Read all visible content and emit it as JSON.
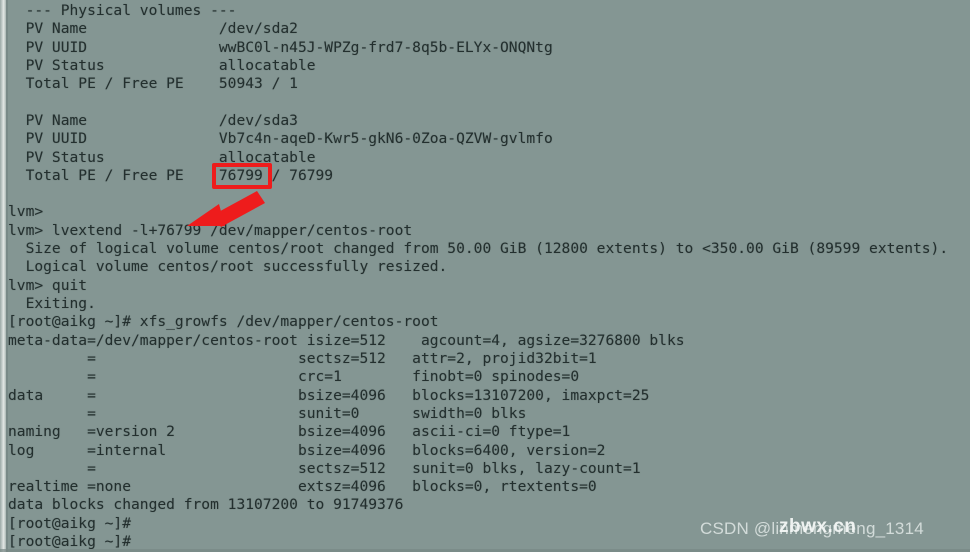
{
  "terminal": {
    "background_color": "#849693",
    "text_color": "#232f2e",
    "lines": [
      "  --- Physical volumes ---",
      "  PV Name               /dev/sda2",
      "  PV UUID               wwBC0l-n45J-WPZg-frd7-8q5b-ELYx-ONQNtg",
      "  PV Status             allocatable",
      "  Total PE / Free PE    50943 / 1",
      "",
      "  PV Name               /dev/sda3",
      "  PV UUID               Vb7c4n-aqeD-Kwr5-gkN6-0Zoa-QZVW-gvlmfo",
      "  PV Status             allocatable",
      "  Total PE / Free PE    76799 / 76799",
      "",
      "lvm>",
      "lvm> lvextend -l+76799 /dev/mapper/centos-root",
      "  Size of logical volume centos/root changed from 50.00 GiB (12800 extents) to <350.00 GiB (89599 extents).",
      "  Logical volume centos/root successfully resized.",
      "lvm> quit",
      "  Exiting.",
      "[root@aikg ~]# xfs_growfs /dev/mapper/centos-root",
      "meta-data=/dev/mapper/centos-root isize=512    agcount=4, agsize=3276800 blks",
      "         =                       sectsz=512   attr=2, projid32bit=1",
      "         =                       crc=1        finobt=0 spinodes=0",
      "data     =                       bsize=4096   blocks=13107200, imaxpct=25",
      "         =                       sunit=0      swidth=0 blks",
      "naming   =version 2              bsize=4096   ascii-ci=0 ftype=1",
      "log      =internal               bsize=4096   blocks=6400, version=2",
      "         =                       sectsz=512   sunit=0 blks, lazy-count=1",
      "realtime =none                   extsz=4096   blocks=0, rtextents=0",
      "data blocks changed from 13107200 to 91749376",
      "[root@aikg ~]#",
      "[root@aikg ~]#"
    ]
  },
  "annotations": {
    "color": "#ee1c1c",
    "highlight_box": {
      "label": "76799",
      "description": "red rectangle around Total PE value 76799"
    },
    "arrow": {
      "description": "red arrow pointing from the highlighted 76799 down-left toward the lvextend -l+76799 command"
    }
  },
  "watermarks": {
    "csdn": "CSDN @linmengmeng_1314",
    "site": "zbwx.cn"
  }
}
